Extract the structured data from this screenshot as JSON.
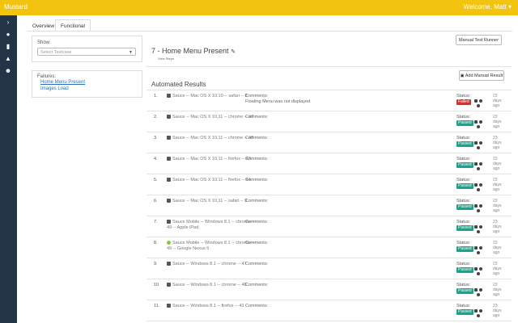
{
  "app": {
    "brand": "Mustard",
    "welcome": "Welcome, Matt ▾"
  },
  "sidebar": {
    "icons": [
      "chevron-right-icon",
      "car-icon",
      "chart-icon",
      "flask-icon",
      "users-icon"
    ]
  },
  "tabs": [
    {
      "label": "Overview",
      "active": false
    },
    {
      "label": "Functional",
      "active": true
    }
  ],
  "filter": {
    "show_label": "Show:",
    "placeholder": "Select Testcase"
  },
  "failures": {
    "title": "Failures:",
    "items": [
      "Home Menu Present",
      "Images Load"
    ]
  },
  "header": {
    "runner_button": "Manual Test Runner",
    "test_title": "7 - Home Menu Present",
    "view_steps": "View Steps"
  },
  "results": {
    "title": "Automated Results",
    "add_button": "Add Manual Result",
    "status_label": "Status:",
    "comments_label": "Comments:",
    "rows": [
      {
        "num": "1.",
        "os": "apple",
        "platform": "Sauce -- Mac OS X 10.10 -- safari -- 8",
        "comment": "Floating Menu was not displayed",
        "status": "Failed",
        "days": "23 days ago"
      },
      {
        "num": "2.",
        "os": "apple",
        "platform": "Sauce -- Mac OS X 10.11 -- chrome -- 47",
        "comment": "",
        "status": "Passed",
        "days": "23 days ago"
      },
      {
        "num": "3.",
        "os": "apple",
        "platform": "Sauce -- Mac OS X 10.11 -- chrome -- 48",
        "comment": "",
        "status": "Passed",
        "days": "23 days ago"
      },
      {
        "num": "4.",
        "os": "apple",
        "platform": "Sauce -- Mac OS X 10.11 -- firefox -- 43",
        "comment": "",
        "status": "Passed",
        "days": "23 days ago"
      },
      {
        "num": "5.",
        "os": "apple",
        "platform": "Sauce -- Mac OS X 10.11 -- firefox -- 44",
        "comment": "",
        "status": "Passed",
        "days": "23 days ago"
      },
      {
        "num": "6.",
        "os": "apple",
        "platform": "Sauce -- Mac OS X 10.11 -- safari -- 9",
        "comment": "",
        "status": "Passed",
        "days": "23 days ago"
      },
      {
        "num": "7.",
        "os": "apple",
        "platform": "Sauce Mobile -- Windows 8.1 -- chrome -- 49 -- Apple iPad",
        "comment": "",
        "status": "Passed",
        "days": "23 days ago"
      },
      {
        "num": "8.",
        "os": "android",
        "platform": "Sauce Mobile -- Windows 8.1 -- chrome -- 49 -- Google Nexus 5",
        "comment": "",
        "status": "Passed",
        "days": "23 days ago"
      },
      {
        "num": "9.",
        "os": "windows",
        "platform": "Sauce -- Windows 8.1 -- chrome -- 47",
        "comment": "",
        "status": "Passed",
        "days": "23 days ago"
      },
      {
        "num": "10.",
        "os": "windows",
        "platform": "Sauce -- Windows 8.1 -- chrome -- 48",
        "comment": "",
        "status": "Passed",
        "days": "23 days ago"
      },
      {
        "num": "11.",
        "os": "windows",
        "platform": "Sauce -- Windows 8.1 -- firefox -- 43",
        "comment": "",
        "status": "Passed",
        "days": "23 days ago"
      }
    ]
  },
  "colors": {
    "topbar": "#f2c40f",
    "sidebar": "#243447",
    "passed": "#1aa38a",
    "failed": "#d9302c",
    "link": "#2a6fb5"
  }
}
